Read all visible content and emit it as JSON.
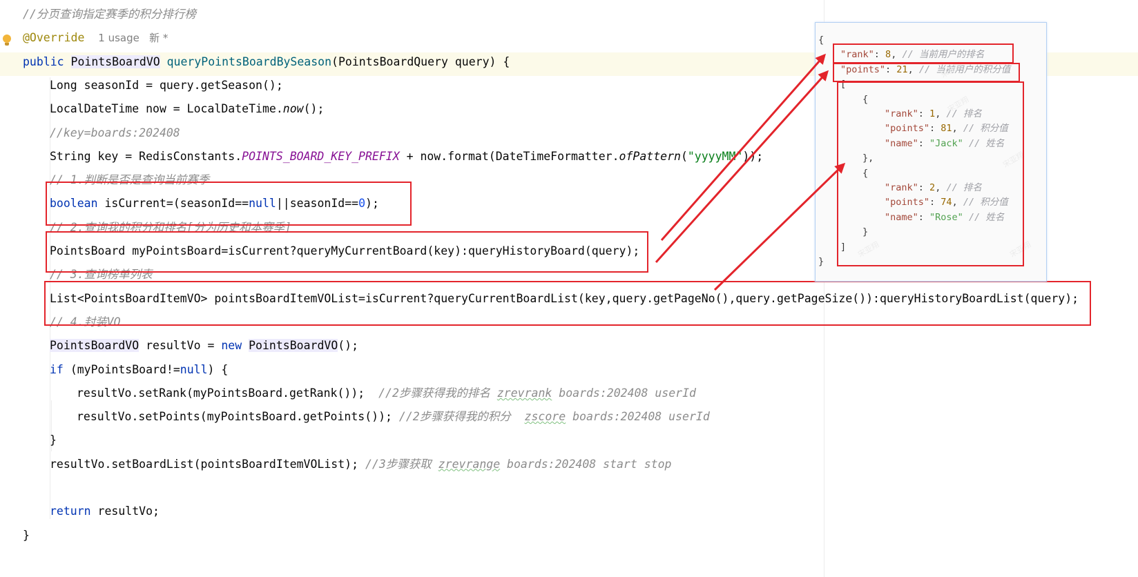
{
  "editor": {
    "lines": [
      {
        "segments": [
          {
            "t": "//分页查询指定赛季的积分排行榜",
            "c": "cm"
          }
        ]
      },
      {
        "segments": [
          {
            "t": "@Override",
            "c": "ann"
          },
          {
            "t": "  "
          },
          {
            "t": "1 usage   新 *",
            "c": "hint"
          }
        ]
      },
      {
        "segments": [
          {
            "t": "public ",
            "c": "kw"
          },
          {
            "t": "PointsBoardVO",
            "c": "hl"
          },
          {
            "t": " "
          },
          {
            "t": "queryPointsBoardBySeason",
            "c": "fn"
          },
          {
            "t": "(PointsBoardQuery query) {"
          }
        ]
      },
      {
        "indent": 1,
        "segments": [
          {
            "t": "Long seasonId = query.getSeason();"
          }
        ]
      },
      {
        "indent": 1,
        "segments": [
          {
            "t": "LocalDateTime now = LocalDateTime."
          },
          {
            "t": "now",
            "c": "it"
          },
          {
            "t": "();"
          }
        ]
      },
      {
        "indent": 1,
        "segments": [
          {
            "t": "//key=boards:202408",
            "c": "cm"
          }
        ]
      },
      {
        "indent": 1,
        "segments": [
          {
            "t": "String key = RedisConstants."
          },
          {
            "t": "POINTS_BOARD_KEY_PREFIX",
            "c": "cst"
          },
          {
            "t": " + now.format(DateTimeFormatter."
          },
          {
            "t": "ofPattern",
            "c": "it"
          },
          {
            "t": "("
          },
          {
            "t": "\"yyyyMM\"",
            "c": "str"
          },
          {
            "t": "));"
          }
        ]
      },
      {
        "indent": 1,
        "segments": [
          {
            "t": "// 1.判断是否是查询当前赛季",
            "c": "cm"
          }
        ]
      },
      {
        "indent": 1,
        "segments": [
          {
            "t": "boolean ",
            "c": "kw"
          },
          {
            "t": "isCurrent=(seasonId=="
          },
          {
            "t": "null",
            "c": "kw"
          },
          {
            "t": "||seasonId=="
          },
          {
            "t": "0",
            "c": "num"
          },
          {
            "t": ");"
          }
        ]
      },
      {
        "indent": 1,
        "segments": [
          {
            "t": "// 2.查询我的积分和排名[分为历史和本赛季]",
            "c": "cm"
          }
        ]
      },
      {
        "indent": 1,
        "segments": [
          {
            "t": "PointsBoard myPointsBoard=isCurrent?queryMyCurrentBoard(key):queryHistoryBoard(query);"
          }
        ]
      },
      {
        "indent": 1,
        "segments": [
          {
            "t": "// 3.查询榜单列表",
            "c": "cm"
          }
        ]
      },
      {
        "indent": 1,
        "segments": [
          {
            "t": "List<PointsBoardItemVO> pointsBoardItemVOList=isCurrent?queryCurrentBoardList(key,query.getPageNo(),query.getPageSize()):queryHistoryBoardList(query);"
          }
        ]
      },
      {
        "indent": 1,
        "segments": [
          {
            "t": "// 4.封装VO",
            "c": "cm"
          }
        ]
      },
      {
        "indent": 1,
        "segments": [
          {
            "t": "PointsBoardVO",
            "c": "hl"
          },
          {
            "t": " resultVo = "
          },
          {
            "t": "new ",
            "c": "kw"
          },
          {
            "t": "PointsBoardVO",
            "c": "hl"
          },
          {
            "t": "();"
          }
        ]
      },
      {
        "indent": 1,
        "segments": [
          {
            "t": "if ",
            "c": "kw"
          },
          {
            "t": "(myPointsBoard!="
          },
          {
            "t": "null",
            "c": "kw"
          },
          {
            "t": ") {"
          }
        ]
      },
      {
        "indent": 2,
        "segments": [
          {
            "t": "resultVo.setRank(myPointsBoard.getRank());  "
          },
          {
            "t": "//2步骤获得我的排名 ",
            "c": "cm"
          },
          {
            "t": "zrevrank",
            "c": "cm und"
          },
          {
            "t": " boards:202408 userId",
            "c": "cm"
          }
        ]
      },
      {
        "indent": 2,
        "segments": [
          {
            "t": "resultVo.setPoints(myPointsBoard.getPoints()); "
          },
          {
            "t": "//2步骤获得我的积分  ",
            "c": "cm"
          },
          {
            "t": "zscore",
            "c": "cm und"
          },
          {
            "t": " boards:202408 userId",
            "c": "cm"
          }
        ]
      },
      {
        "indent": 1,
        "segments": [
          {
            "t": "}"
          }
        ]
      },
      {
        "indent": 1,
        "segments": [
          {
            "t": "resultVo.setBoardList(pointsBoardItemVOList); "
          },
          {
            "t": "//3步骤获取 ",
            "c": "cm"
          },
          {
            "t": "zrevrange",
            "c": "cm und"
          },
          {
            "t": " boards:202408 start stop",
            "c": "cm"
          }
        ]
      },
      {
        "indent": 1,
        "segments": [
          {
            "t": ""
          }
        ]
      },
      {
        "indent": 1,
        "segments": [
          {
            "t": "return ",
            "c": "kw"
          },
          {
            "t": "resultVo;"
          }
        ]
      },
      {
        "segments": [
          {
            "t": "}"
          }
        ]
      }
    ]
  },
  "json_example": {
    "lines": [
      {
        "indent": 0,
        "segments": [
          {
            "t": "{"
          }
        ]
      },
      {
        "indent": 1,
        "segments": [
          {
            "t": "\"rank\"",
            "c": "jk"
          },
          {
            "t": ": "
          },
          {
            "t": "8",
            "c": "jn"
          },
          {
            "t": ", "
          },
          {
            "t": "// 当前用户的排名",
            "c": "jc"
          }
        ]
      },
      {
        "indent": 1,
        "segments": [
          {
            "t": "\"points\"",
            "c": "jk"
          },
          {
            "t": ": "
          },
          {
            "t": "21",
            "c": "jn"
          },
          {
            "t": ", "
          },
          {
            "t": "// 当前用户的积分值",
            "c": "jc"
          }
        ]
      },
      {
        "indent": 1,
        "segments": [
          {
            "t": "["
          }
        ]
      },
      {
        "indent": 2,
        "segments": [
          {
            "t": "{"
          }
        ]
      },
      {
        "indent": 3,
        "segments": [
          {
            "t": "\"rank\"",
            "c": "jk"
          },
          {
            "t": ": "
          },
          {
            "t": "1",
            "c": "jn"
          },
          {
            "t": ", "
          },
          {
            "t": "// 排名",
            "c": "jc"
          }
        ]
      },
      {
        "indent": 3,
        "segments": [
          {
            "t": "\"points\"",
            "c": "jk"
          },
          {
            "t": ": "
          },
          {
            "t": "81",
            "c": "jn"
          },
          {
            "t": ", "
          },
          {
            "t": "// 积分值",
            "c": "jc"
          }
        ]
      },
      {
        "indent": 3,
        "segments": [
          {
            "t": "\"name\"",
            "c": "jk"
          },
          {
            "t": ": "
          },
          {
            "t": "\"Jack\"",
            "c": "js"
          },
          {
            "t": " "
          },
          {
            "t": "// 姓名",
            "c": "jc"
          }
        ]
      },
      {
        "indent": 2,
        "segments": [
          {
            "t": "},"
          }
        ]
      },
      {
        "indent": 2,
        "segments": [
          {
            "t": "{"
          }
        ]
      },
      {
        "indent": 3,
        "segments": [
          {
            "t": "\"rank\"",
            "c": "jk"
          },
          {
            "t": ": "
          },
          {
            "t": "2",
            "c": "jn"
          },
          {
            "t": ", "
          },
          {
            "t": "// 排名",
            "c": "jc"
          }
        ]
      },
      {
        "indent": 3,
        "segments": [
          {
            "t": "\"points\"",
            "c": "jk"
          },
          {
            "t": ": "
          },
          {
            "t": "74",
            "c": "jn"
          },
          {
            "t": ", "
          },
          {
            "t": "// 积分值",
            "c": "jc"
          }
        ]
      },
      {
        "indent": 3,
        "segments": [
          {
            "t": "\"name\"",
            "c": "jk"
          },
          {
            "t": ": "
          },
          {
            "t": "\"Rose\"",
            "c": "js"
          },
          {
            "t": " "
          },
          {
            "t": "// 姓名",
            "c": "jc"
          }
        ]
      },
      {
        "indent": 2,
        "segments": [
          {
            "t": "}"
          }
        ]
      },
      {
        "indent": 1,
        "segments": [
          {
            "t": "]"
          }
        ]
      },
      {
        "indent": 0,
        "segments": [
          {
            "t": "}"
          }
        ]
      }
    ]
  },
  "colors": {
    "annotation_red": "#e3242b",
    "comment": "#8c8c8c",
    "keyword": "#0033b3",
    "method": "#00627a"
  }
}
